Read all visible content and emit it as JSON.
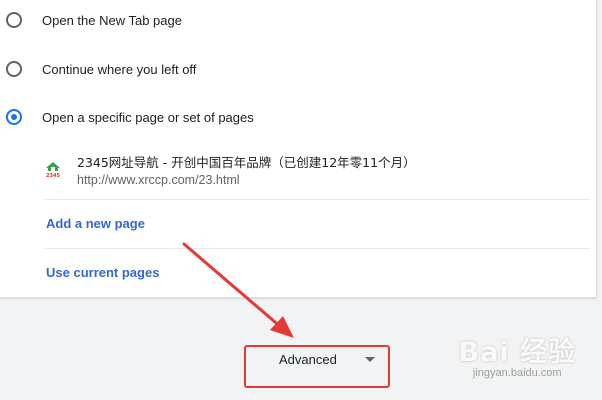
{
  "startup": {
    "options": [
      {
        "label": "Open the New Tab page",
        "checked": false
      },
      {
        "label": "Continue where you left off",
        "checked": false
      },
      {
        "label": "Open a specific page or set of pages",
        "checked": true
      }
    ],
    "page_entry": {
      "title": "2345网址导航 - 开创中国百年品牌（已创建12年零11个月）",
      "url": "http://www.xrccp.com/23.html",
      "favicon_text": "2345"
    },
    "add_page_label": "Add a new page",
    "use_current_label": "Use current pages"
  },
  "advanced": {
    "label": "Advanced"
  },
  "watermark": {
    "main": "Bai 经验",
    "sub": "jingyan.baidu.com"
  },
  "colors": {
    "accent": "#1a73e8",
    "link": "#3367d6",
    "annotation_red": "#e53935"
  },
  "icons": {
    "favicon": "house-favicon-icon",
    "advanced_chevron": "chevron-down-icon"
  }
}
